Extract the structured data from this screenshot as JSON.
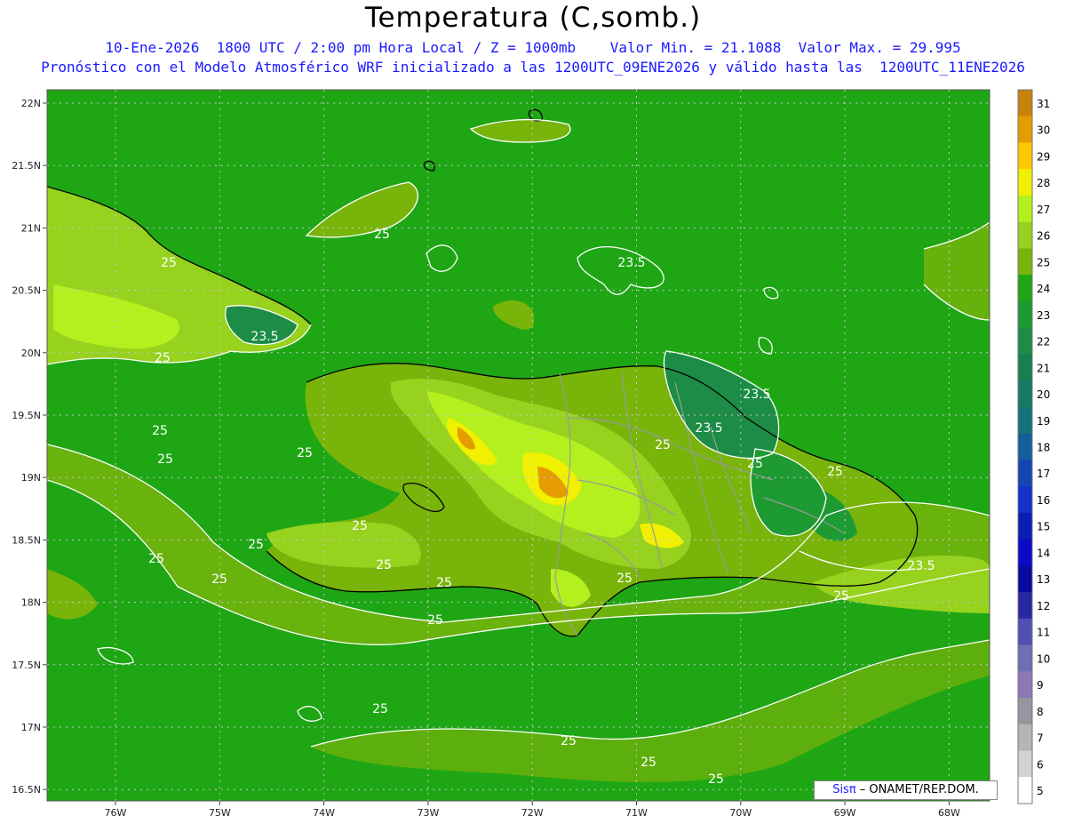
{
  "title": "Temperatura (C,somb.)",
  "subtitle_line1": "10-Ene-2026  1800 UTC / 2:00 pm Hora Local / Z = 1000mb    Valor Min. = 21.1088  Valor Max. = 29.995",
  "subtitle_line2": "Pronóstico con el Modelo Atmosférico WRF inicializado a las 1200UTC_09ENE2026 y válido hasta las  1200UTC_11ENE2026",
  "credit": {
    "brand": "Sisπ",
    "text": " – ONAMET/REP.DOM."
  },
  "axes": {
    "lat_ticks": [
      "22N",
      "21.5N",
      "21N",
      "20.5N",
      "20N",
      "19.5N",
      "19N",
      "18.5N",
      "18N",
      "17.5N",
      "17N",
      "16.5N"
    ],
    "lon_ticks": [
      "76W",
      "75W",
      "74W",
      "73W",
      "72W",
      "71W",
      "70W",
      "69W",
      "68W"
    ]
  },
  "colorbar": {
    "levels": [
      "31",
      "30",
      "29",
      "28",
      "27",
      "26",
      "25",
      "24",
      "23",
      "22",
      "21",
      "20",
      "19",
      "18",
      "17",
      "16",
      "15",
      "14",
      "13",
      "12",
      "11",
      "10",
      "9",
      "8",
      "7",
      "6",
      "5"
    ],
    "colors": [
      "#c8820a",
      "#e59c00",
      "#ffc800",
      "#f0f000",
      "#b4f01e",
      "#96d21e",
      "#78b40a",
      "#1ea614",
      "#1e9a32",
      "#1c8c46",
      "#168050",
      "#147a62",
      "#14727a",
      "#145e9a",
      "#1446b4",
      "#1432c8",
      "#0a1eb4",
      "#0a0ac8",
      "#0a0aa0",
      "#2828a0",
      "#5050b4",
      "#6e6eb4",
      "#8c78b4",
      "#9696a0",
      "#b4b4b4",
      "#d2d2d2",
      "#ffffff"
    ]
  },
  "contour_labels": [
    "25",
    "25",
    "25",
    "25",
    "25",
    "25",
    "25",
    "25",
    "25",
    "25",
    "25",
    "25",
    "25",
    "25",
    "25",
    "25",
    "25",
    "25",
    "25",
    "25",
    "25",
    "25",
    "23.5",
    "23.5",
    "23.5",
    "23.5",
    "23.5"
  ],
  "colors": {
    "ocean": "#1ea614",
    "land_warm": "#78b40a",
    "title_blue": "#1a1aff"
  }
}
